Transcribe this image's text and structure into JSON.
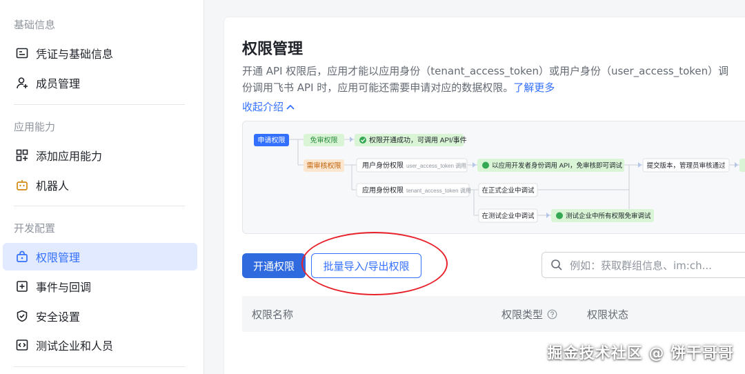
{
  "sidebar": {
    "sections": [
      {
        "title": "基础信息"
      },
      {
        "title": "应用能力"
      },
      {
        "title": "开发配置"
      }
    ],
    "items": [
      {
        "label": "凭证与基础信息",
        "icon": "credential-icon"
      },
      {
        "label": "成员管理",
        "icon": "user-add-icon"
      },
      {
        "label": "添加应用能力",
        "icon": "grid-add-icon"
      },
      {
        "label": "机器人",
        "icon": "robot-icon"
      },
      {
        "label": "权限管理",
        "icon": "lock-box-icon",
        "active": true
      },
      {
        "label": "事件与回调",
        "icon": "event-icon"
      },
      {
        "label": "安全设置",
        "icon": "shield-icon"
      },
      {
        "label": "测试企业和人员",
        "icon": "code-icon"
      }
    ]
  },
  "main": {
    "title": "权限管理",
    "desc_line1": "开通 API 权限后，应用才能以应用身份（tenant_access_token）或用户身份（user_access_token）调",
    "desc_line2": "份调用飞书 API 时，应用可能还需要申请对应的数据权限。",
    "learn_more": "了解更多",
    "collapse": "收起介绍",
    "flow": {
      "apply": "申请权限",
      "no_review": "免审权限",
      "success": "权限开通成功，可调用 API/事件",
      "need_review": "需审核权限",
      "user_perm": "用户身份权限",
      "user_token": "user_access_token 调用",
      "dev_call": "以应用开发者身份调用 API，免审核即可调试",
      "submit": "提交版本，管理员审核通过",
      "app_perm": "应用身份权限",
      "tenant_token": "tenant_access_token 调用",
      "prod_debug": "在正式企业中调试",
      "test_debug": "在测试企业中调试",
      "test_free": "测试企业中所有权限免审调试"
    },
    "buttons": {
      "enable": "开通权限",
      "batch": "批量导入/导出权限"
    },
    "search": {
      "placeholder": "例如：获取群组信息、im:ch..."
    },
    "table": {
      "col_name": "权限名称",
      "col_type": "权限类型",
      "col_status": "权限状态"
    }
  },
  "watermark": "掘金技术社区 @ 饼干哥哥",
  "colors": {
    "accent": "#3370ff",
    "highlight_ring": "#e8212a"
  }
}
